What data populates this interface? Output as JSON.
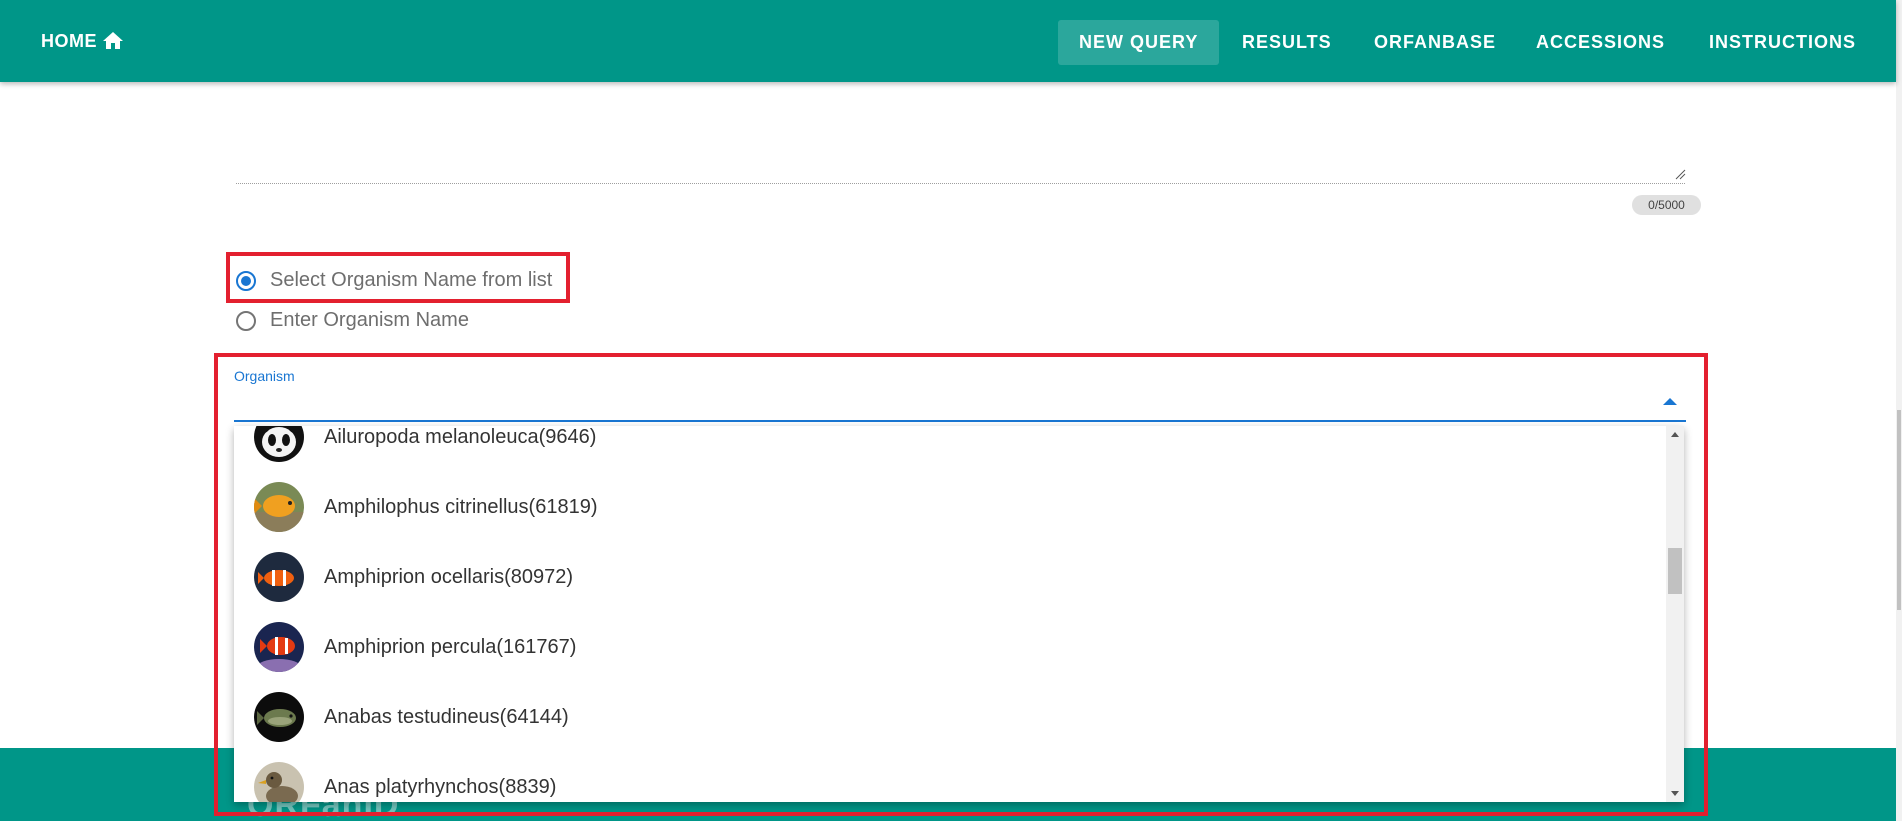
{
  "nav": {
    "home_label": "HOME",
    "items": [
      {
        "label": "NEW QUERY",
        "active": true
      },
      {
        "label": "RESULTS"
      },
      {
        "label": "ORFANBASE"
      },
      {
        "label": "ACCESSIONS"
      },
      {
        "label": "INSTRUCTIONS"
      }
    ]
  },
  "form": {
    "char_counter": "0/5000",
    "radio_options": [
      {
        "label": "Select Organism Name from list",
        "checked": true
      },
      {
        "label": "Enter Organism Name",
        "checked": false
      }
    ],
    "organism_field_label": "Organism",
    "organism_options": [
      {
        "name": "Ailuropoda melanoleuca(9646)",
        "icon": "panda"
      },
      {
        "name": "Amphilophus citrinellus(61819)",
        "icon": "orange-fish"
      },
      {
        "name": "Amphiprion ocellaris(80972)",
        "icon": "clownfish"
      },
      {
        "name": "Amphiprion percula(161767)",
        "icon": "clownfish-reef"
      },
      {
        "name": "Anabas testudineus(64144)",
        "icon": "perch"
      },
      {
        "name": "Anas platyrhynchos(8839)",
        "icon": "duck"
      }
    ]
  },
  "footer": {
    "brand": "ORFanID"
  },
  "colors": {
    "primary": "#009688",
    "accent": "#1976d2",
    "highlight": "#e3202f"
  }
}
